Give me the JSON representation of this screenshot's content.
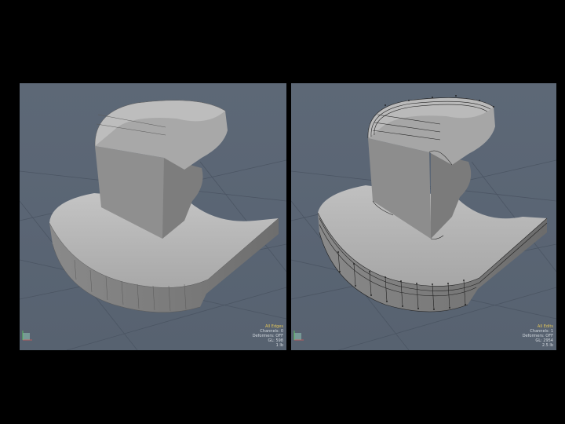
{
  "viewports": [
    {
      "mode": "All Edges",
      "channels": "Channels: 0",
      "deformers": "Deformers: OFF",
      "gl": "GL: 598",
      "units": "1 lb"
    },
    {
      "mode": "All Edits",
      "channels": "Channels: 1",
      "deformers": "Deformers: OFF",
      "gl": "GL: 2954",
      "units": "2.5 lb"
    }
  ],
  "colors": {
    "background": "#000000",
    "viewport": "#5a6574",
    "grid": "#4b5563",
    "mesh_light": "#b8b8b8",
    "mesh_mid": "#9a9a9a",
    "mesh_dark": "#7a7a7a",
    "hud_highlight": "#e3c55a"
  },
  "icons": [
    "axis-orientation-icon",
    "axis-orientation-icon"
  ]
}
